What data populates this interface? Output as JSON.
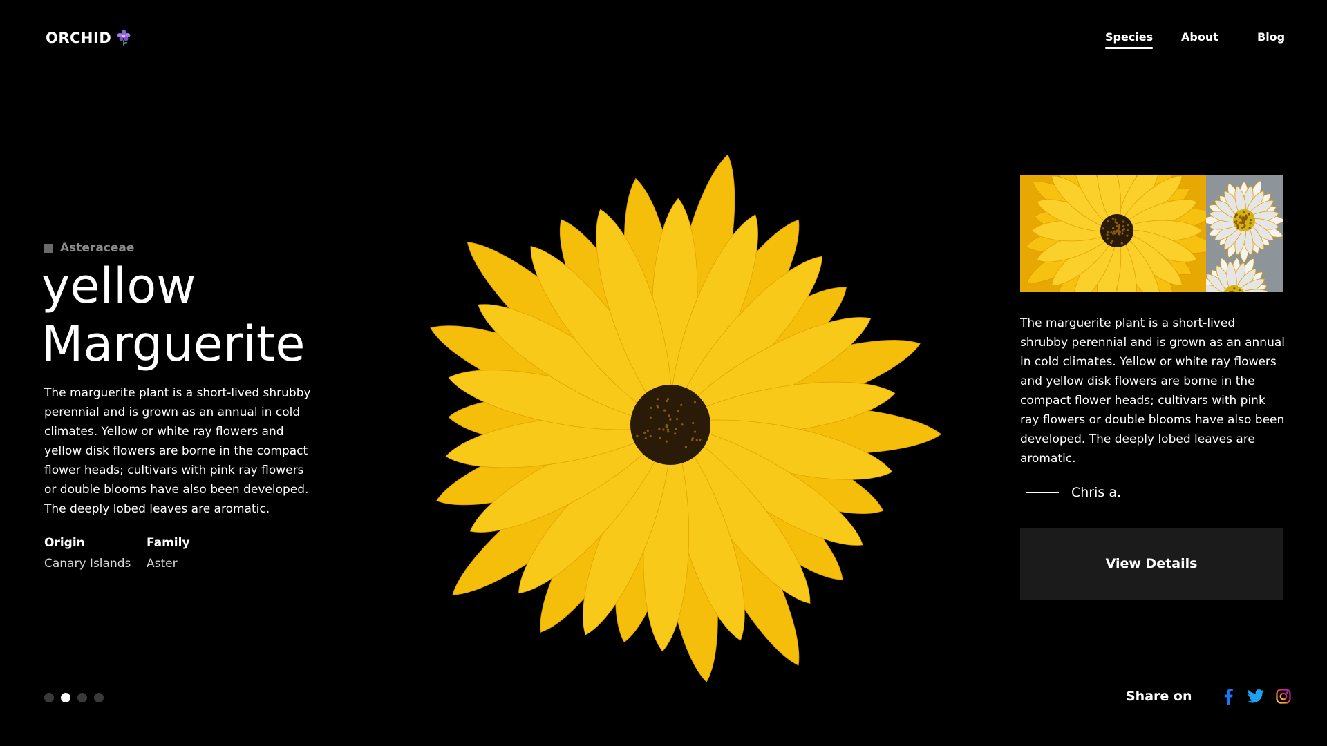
{
  "brand": {
    "name": "ORCHID",
    "icon": "orchid-flower-icon",
    "icon_color": "#8e63d9"
  },
  "nav": {
    "items": [
      {
        "label": "Species",
        "active": true
      },
      {
        "label": "About",
        "active": false
      },
      {
        "label": "Blog",
        "active": false
      }
    ]
  },
  "species": {
    "family_tag": "Asteraceae",
    "title_line1": "yellow",
    "title_line2": "Marguerite",
    "description": "The marguerite plant is a short-lived shrubby perennial and is grown as an annual in cold climates. Yellow or white ray flowers and yellow disk flowers are borne in the compact flower heads; cultivars with pink ray flowers or double blooms have also been developed. The deeply lobed leaves are aromatic.",
    "origin_label": "Origin",
    "origin_value": "Canary Islands",
    "family_label": "Family",
    "family_value": "Aster"
  },
  "pagination": {
    "total": 4,
    "active_index": 1
  },
  "sidebar": {
    "description": "The marguerite plant is a short-lived shrubby perennial and is grown as an annual in cold climates. Yellow or white ray flowers and yellow disk flowers are borne in the compact flower heads; cultivars with pink ray flowers or double blooms have also been developed. The deeply lobed leaves are aromatic.",
    "author": "Chris a.",
    "button_label": "View Details"
  },
  "share": {
    "label": "Share on",
    "networks": [
      "facebook-icon",
      "twitter-icon",
      "instagram-icon"
    ]
  },
  "colors": {
    "background": "#000000",
    "petal": "#f5be0b",
    "button_bg": "#1b1b1b",
    "facebook": "#1877f2",
    "twitter": "#1da1f2",
    "instagram": "#e1306c"
  }
}
